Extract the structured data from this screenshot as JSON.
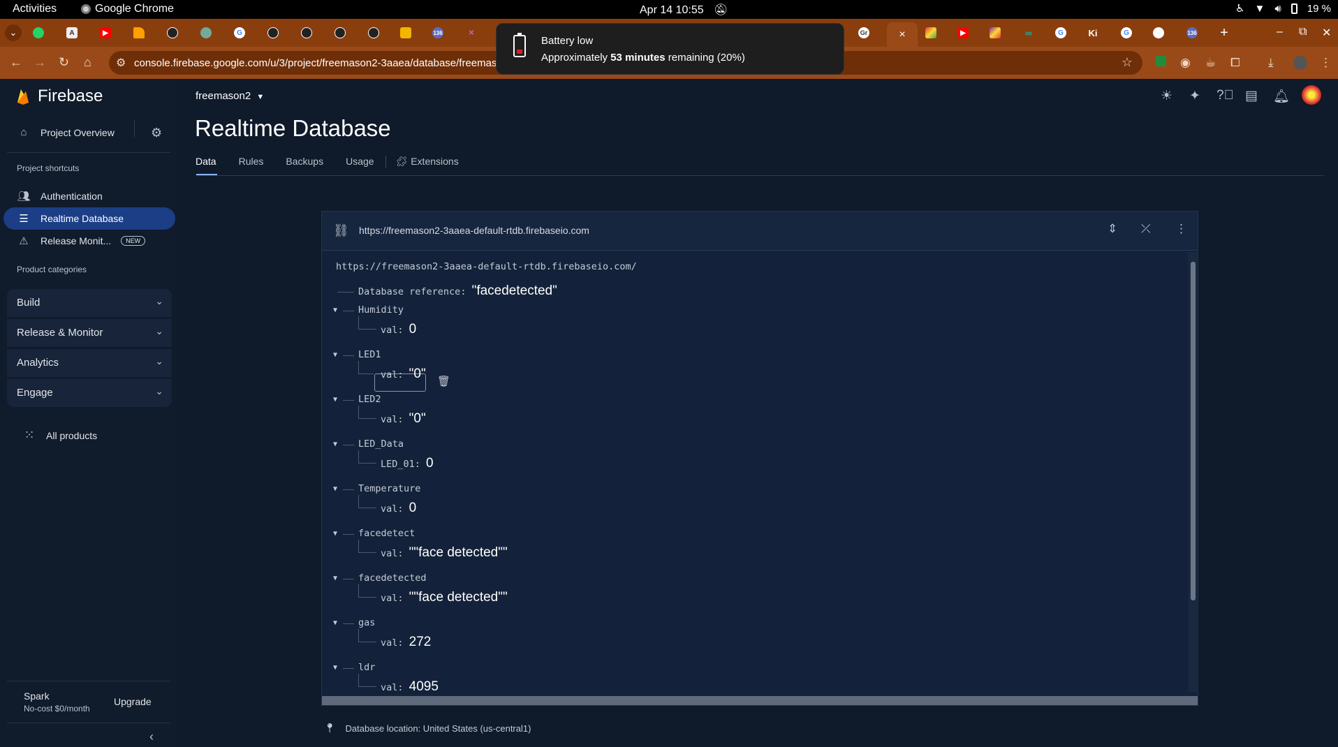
{
  "os": {
    "activities": "Activities",
    "app_name": "Google Chrome",
    "clock": "Apr 14  10:55",
    "battery_pct": "19 %"
  },
  "notification": {
    "title": "Battery low",
    "text_pre": "Approximately ",
    "text_bold": "53 minutes",
    "text_post": " remaining (20%)"
  },
  "browser": {
    "url": "console.firebase.google.com/u/3/project/freemason2-3aaea/database/freemason2",
    "close_tab": "×",
    "new_tab": "+"
  },
  "firebase": {
    "brand": "Firebase",
    "project_overview": "Project Overview",
    "shortcuts_label": "Project shortcuts",
    "shortcuts": [
      {
        "label": "Authentication"
      },
      {
        "label": "Realtime Database"
      },
      {
        "label": "Release Monit...",
        "badge": "NEW"
      }
    ],
    "categories_label": "Product categories",
    "categories": [
      "Build",
      "Release & Monitor",
      "Analytics",
      "Engage"
    ],
    "all_products": "All products",
    "plan": "Spark",
    "plan_sub": "No-cost $0/month",
    "upgrade": "Upgrade",
    "project_name": "freemason2",
    "page_title": "Realtime Database",
    "tabs": [
      "Data",
      "Rules",
      "Backups",
      "Usage",
      "Extensions"
    ]
  },
  "db": {
    "header_url": "https://freemason2-3aaea-default-rtdb.firebaseio.com",
    "root_url": "https://freemason2-3aaea-default-rtdb.firebaseio.com/",
    "entries": [
      {
        "key": "Database reference",
        "value": "\"facedetected\""
      },
      {
        "key": "Humidity",
        "child_key": "val",
        "child_value": "0"
      },
      {
        "key": "LED1",
        "child_key": "val",
        "child_value": "\"0\""
      },
      {
        "key": "LED2",
        "child_key": "val",
        "child_value": "\"0\""
      },
      {
        "key": "LED_Data",
        "child_key": "LED_01",
        "child_value": "0"
      },
      {
        "key": "Temperature",
        "child_key": "val",
        "child_value": "0"
      },
      {
        "key": "facedetect",
        "child_key": "val",
        "child_value": "\"\"face detected\"\""
      },
      {
        "key": "facedetected",
        "child_key": "val",
        "child_value": "\"\"face detected\"\""
      },
      {
        "key": "gas",
        "child_key": "val",
        "child_value": "272"
      },
      {
        "key": "ldr",
        "child_key": "val",
        "child_value": "4095"
      }
    ],
    "location": "Database location: United States (us-central1)"
  }
}
